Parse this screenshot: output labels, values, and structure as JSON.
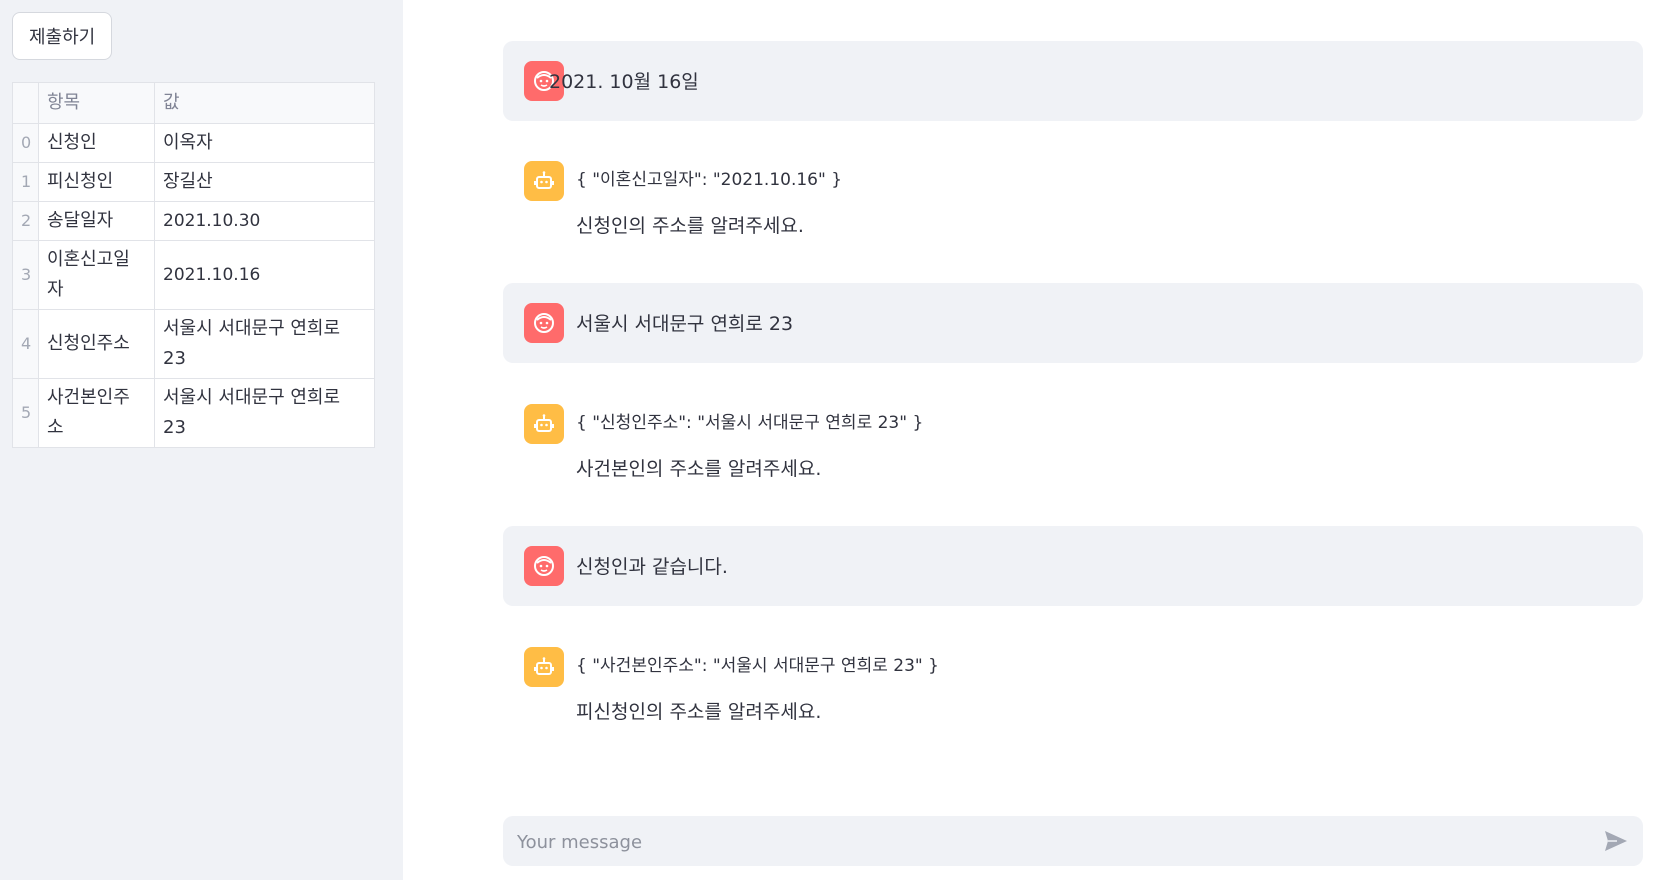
{
  "sidebar": {
    "submit_label": "제출하기",
    "table": {
      "headers": [
        "항목",
        "값"
      ],
      "rows": [
        {
          "index": "0",
          "item": "신청인",
          "value": "이옥자"
        },
        {
          "index": "1",
          "item": "피신청인",
          "value": "장길산"
        },
        {
          "index": "2",
          "item": "송달일자",
          "value": "2021.10.30"
        },
        {
          "index": "3",
          "item": "이혼신고일자",
          "value": "2021.10.16"
        },
        {
          "index": "4",
          "item": "신청인주소",
          "value": "서울시 서대문구 연희로 23"
        },
        {
          "index": "5",
          "item": "사건본인주소",
          "value": "서울시 서대문구 연희로 23"
        }
      ]
    }
  },
  "chat": {
    "messages": [
      {
        "role": "user",
        "text": "2021.   10월 16일"
      },
      {
        "role": "assistant",
        "json_text": "{ \"이혼신고일자\": \"2021.10.16\" }",
        "text": "신청인의 주소를 알려주세요."
      },
      {
        "role": "user",
        "text": "서울시 서대문구 연희로 23"
      },
      {
        "role": "assistant",
        "json_text": "{ \"신청인주소\": \"서울시 서대문구 연희로 23\" }",
        "text": "사건본인의 주소를 알려주세요."
      },
      {
        "role": "user",
        "text": "신청인과 같습니다."
      },
      {
        "role": "assistant",
        "json_text": "{ \"사건본인주소\": \"서울시 서대문구 연희로 23\" }",
        "text": "피신청인의 주소를 알려주세요."
      }
    ],
    "input_placeholder": "Your message"
  },
  "colors": {
    "user_avatar": "#ff6b6b",
    "assistant_avatar": "#ffbd45",
    "sidebar_bg": "#f0f2f6"
  },
  "icons": {
    "user_avatar": "face-icon",
    "assistant_avatar": "robot-icon",
    "send": "send-arrow-icon"
  }
}
